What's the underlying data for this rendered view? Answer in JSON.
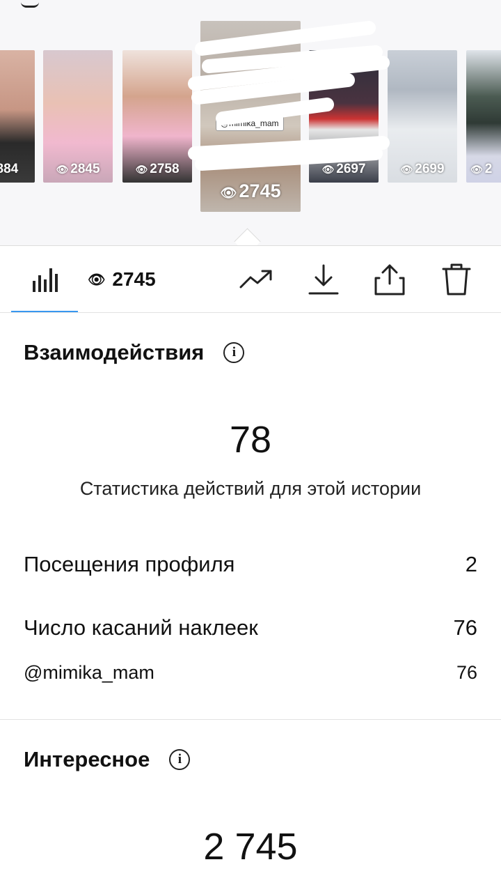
{
  "carousel": {
    "thumbnails": [
      {
        "views": "884"
      },
      {
        "views": "2845"
      },
      {
        "views": "2758"
      },
      {
        "views": "2745",
        "selected": true,
        "sticker": "@mimika_mam"
      },
      {
        "views": "2697"
      },
      {
        "views": "2699"
      },
      {
        "views": "2"
      }
    ]
  },
  "toolbar": {
    "views_count": "2745",
    "icons": [
      "bar-chart-icon",
      "eye-icon",
      "trending-icon",
      "download-icon",
      "share-icon",
      "trash-icon"
    ]
  },
  "interactions": {
    "title": "Взаимодействия",
    "total": "78",
    "caption": "Статистика действий для этой истории",
    "rows": [
      {
        "label": "Посещения профиля",
        "value": "2"
      },
      {
        "label": "Число касаний наклеек",
        "value": "76"
      },
      {
        "label": "@mimika_mam",
        "value": "76"
      }
    ]
  },
  "discovery": {
    "title": "Интересное",
    "total": "2 745"
  },
  "colors": {
    "accent": "#3897f0",
    "text": "#111111",
    "divider": "#e2e2e2"
  }
}
